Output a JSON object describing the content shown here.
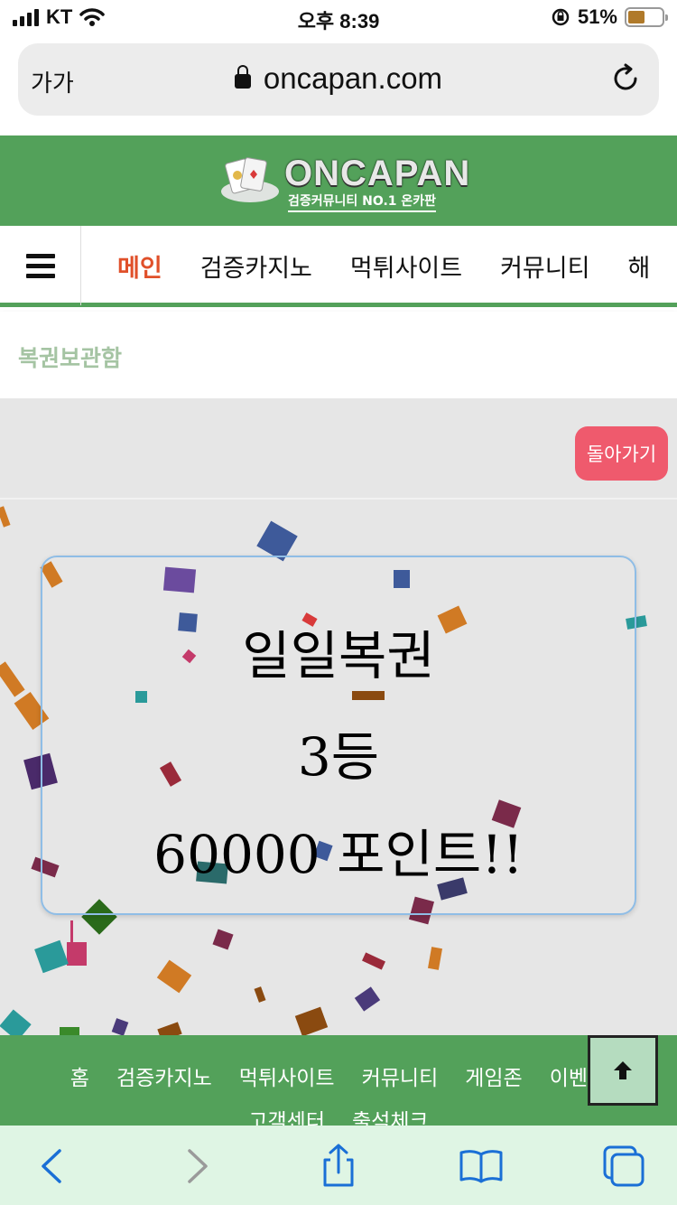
{
  "status": {
    "carrier": "KT",
    "time": "오후 8:39",
    "battery_percent": "51%",
    "battery_level": 0.51
  },
  "browser": {
    "text_size_label": "가가",
    "domain": "oncapan.com"
  },
  "site": {
    "logo_text": "ONCAPAN",
    "logo_tagline": "검증커뮤니티 NO.1 온카판",
    "nav": [
      "메인",
      "검증카지노",
      "먹튀사이트",
      "커뮤니티",
      "해"
    ],
    "section_title": "복권보관함"
  },
  "main": {
    "back_button": "돌아가기",
    "lottery": {
      "name": "일일복권",
      "rank": "3등",
      "prize": "60000 포인트!!"
    }
  },
  "footer": {
    "row1": [
      "홈",
      "검증카지노",
      "먹튀사이트",
      "커뮤니티",
      "게임존",
      "이벤트"
    ],
    "row2": [
      "고객센터",
      "출석체크"
    ]
  },
  "colors": {
    "brand_green": "#53a15a",
    "nav_active": "#e0502a",
    "back_button": "#ef5a6d",
    "toolbar_icon": "#1a6fd6"
  },
  "icons": [
    "signal-icon",
    "wifi-icon",
    "lock-icon",
    "reload-icon",
    "rotation-lock-icon",
    "battery-icon",
    "hamburger-icon",
    "arrow-up-icon",
    "back-arrow-icon",
    "forward-arrow-icon",
    "share-icon",
    "bookmarks-icon",
    "tabs-icon"
  ]
}
